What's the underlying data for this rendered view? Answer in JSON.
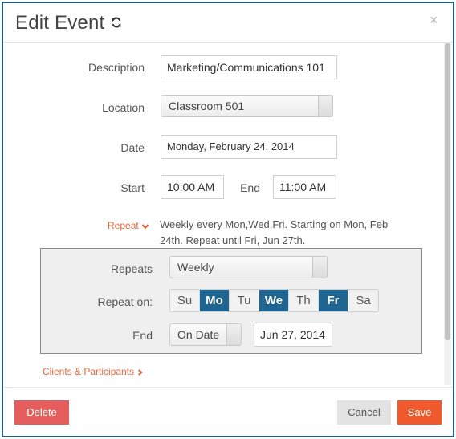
{
  "dialog": {
    "title": "Edit Event",
    "close_label": "×"
  },
  "form": {
    "description": {
      "label": "Description",
      "value": "Marketing/Communications 101"
    },
    "location": {
      "label": "Location",
      "value": "Classroom 501"
    },
    "date": {
      "label": "Date",
      "value": "Monday, February 24, 2014"
    },
    "start": {
      "label": "Start",
      "value": "10:00 AM"
    },
    "end": {
      "label": "End",
      "value": "11:00 AM"
    }
  },
  "repeat": {
    "link_label": "Repeat",
    "summary": "Weekly every Mon,Wed,Fri. Starting on Mon, Feb 24th. Repeat until Fri, Jun 27th.",
    "repeats_label": "Repeats",
    "repeats_value": "Weekly",
    "repeat_on_label": "Repeat on:",
    "days": [
      {
        "label": "Su",
        "selected": false
      },
      {
        "label": "Mo",
        "selected": true
      },
      {
        "label": "Tu",
        "selected": false
      },
      {
        "label": "We",
        "selected": true
      },
      {
        "label": "Th",
        "selected": false
      },
      {
        "label": "Fr",
        "selected": true
      },
      {
        "label": "Sa",
        "selected": false
      }
    ],
    "end_label": "End",
    "end_mode": "On Date",
    "end_date": "Jun 27, 2014"
  },
  "clients_link": "Clients & Participants",
  "footer": {
    "delete_label": "Delete",
    "cancel_label": "Cancel",
    "save_label": "Save"
  },
  "colors": {
    "frame": "#1f5f79",
    "accent": "#e2673d",
    "day_selected": "#1f6591",
    "delete": "#e65d5d",
    "save": "#f05a2c"
  }
}
